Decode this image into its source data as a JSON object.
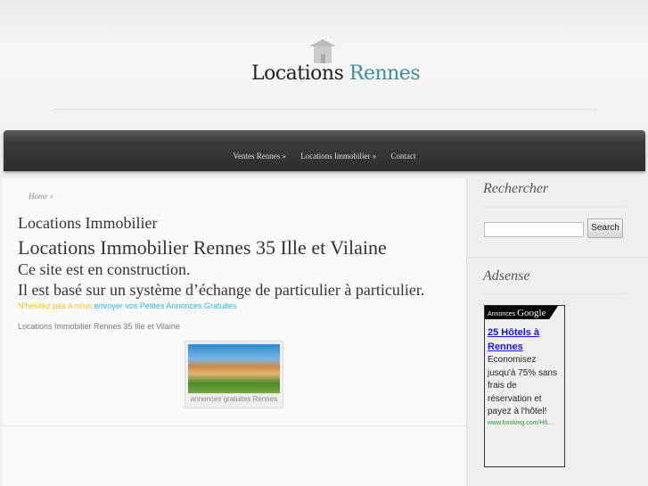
{
  "logo": {
    "part1": "Locations",
    "part2": "Rennes"
  },
  "nav": {
    "items": [
      "Ventes Rennes »",
      "Locations Immobilier »",
      "Contact"
    ]
  },
  "breadcrumb": {
    "home": "Home",
    "sep": "»"
  },
  "main": {
    "title": "Locations Immobilier",
    "heading": "Locations Immobilier Rennes 35 Ille et Vilaine",
    "line1": "Ce site est en construction.",
    "line2": "Il est basé sur un système d’échange de particulier à particulier.",
    "cta_text": "N'hésitez pas à nous",
    "cta_link": "envoyer vos Petites Annonces Gratuites",
    "caption": "Locations Immobilier Rennes 35 Ille et Vilaine",
    "image_caption": "annonces gratuites Rennes"
  },
  "sidebar": {
    "search_title": "Rechercher",
    "search_value": "",
    "search_button": "Search",
    "adsense_title": "Adsense",
    "ad": {
      "label": "Annonces",
      "brand": "Google",
      "title": "25 Hôtels à Rennes",
      "body": "Economisez jusqu'à 75% sans frais de réservation et payez à l'hôtel!",
      "url": "www.booking.com/Hô..."
    }
  }
}
